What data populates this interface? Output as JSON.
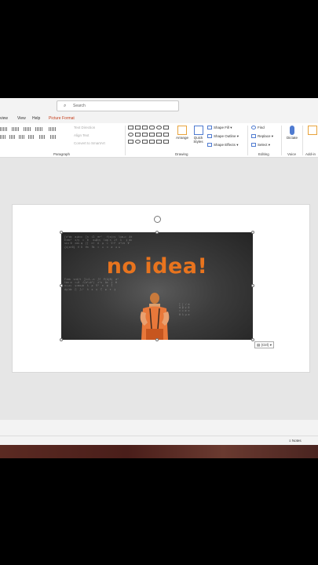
{
  "search": {
    "placeholder": "Search"
  },
  "tabs": {
    "review": "view",
    "help_prev": "View",
    "help": "Help",
    "picture_format": "Picture Format"
  },
  "ribbon": {
    "paragraph": {
      "label": "Paragraph",
      "text_direction": "Text Direction",
      "align_text": "Align Text",
      "convert_smartart": "Convert to SmartArt"
    },
    "drawing": {
      "label": "Drawing",
      "arrange": "Arrange",
      "quick_styles": "Quick Styles",
      "shape_fill": "Shape Fill",
      "shape_outline": "Shape Outline",
      "shape_effects": "Shape Effects"
    },
    "editing": {
      "label": "Editing",
      "find": "Find",
      "replace": "Replace",
      "select": "Select"
    },
    "voice": {
      "label": "Voice",
      "dictate": "Dictate"
    },
    "addins": {
      "label": "Add-in",
      "addins_btn": "Add-in"
    }
  },
  "slide": {
    "image_text": "no idea!",
    "paste_badge": "(Ctrl)"
  },
  "statusbar": {
    "notes": "Notes"
  }
}
